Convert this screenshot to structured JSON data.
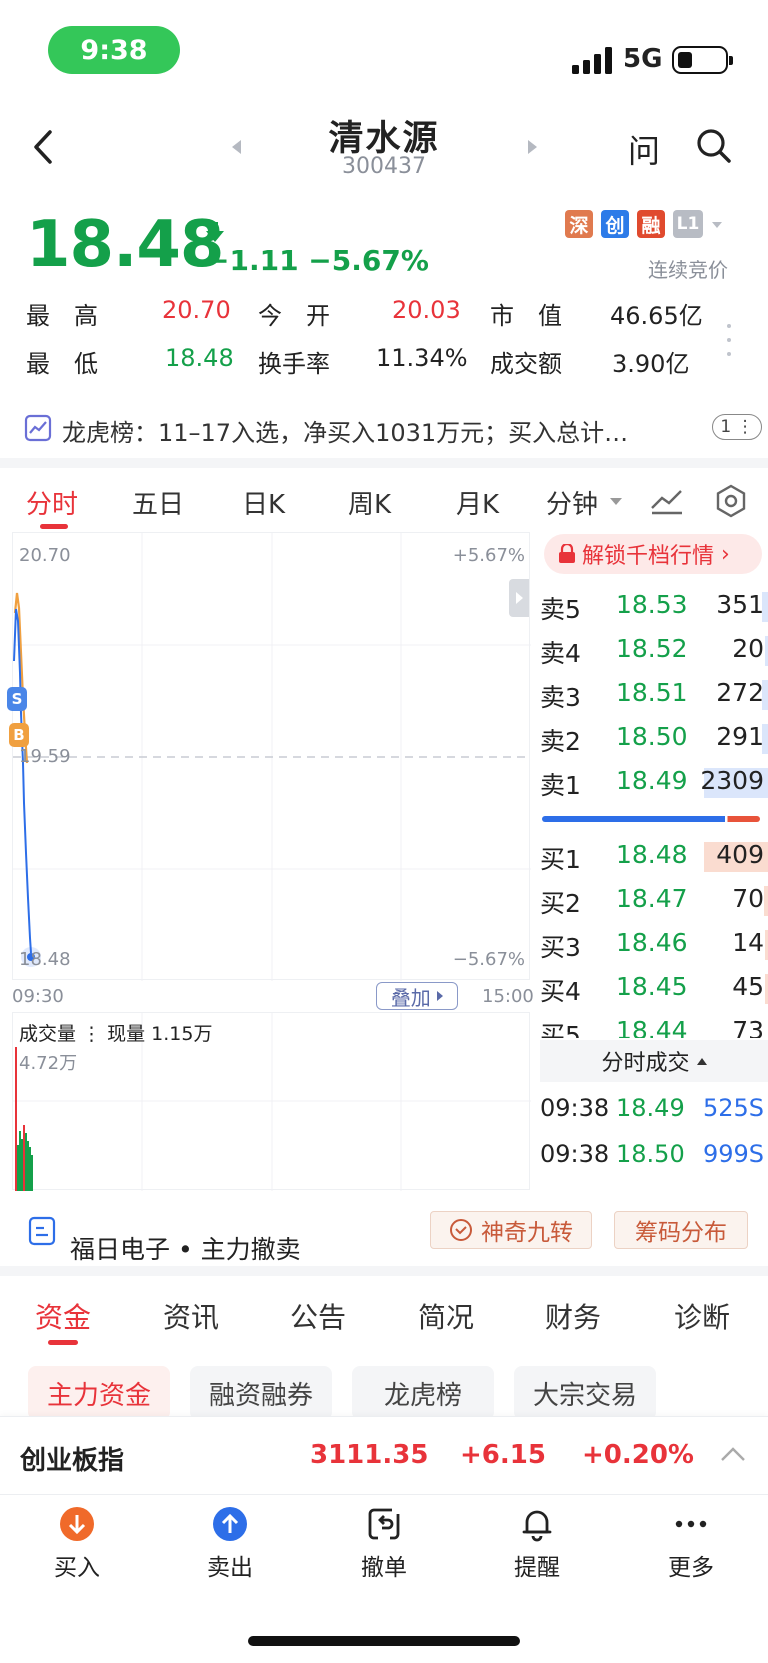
{
  "status_bar": {
    "time": "9:38",
    "network": "5G"
  },
  "header": {
    "name": "清水源",
    "code": "300437",
    "ask_label": "问"
  },
  "quote": {
    "price": "18.48",
    "change": "−1.11",
    "change_pct": "−5.67%",
    "tags": [
      "深",
      "创",
      "融",
      "L1"
    ],
    "tag_colors": [
      "#e07a4f",
      "#2d7be8",
      "#e04a2e",
      "#b8bcc4"
    ],
    "status": "连续竞价"
  },
  "stats": {
    "high_label": "最　高",
    "high": "20.70",
    "open_label": "今　开",
    "open": "20.03",
    "mcap_label": "市　值",
    "mcap": "46.65亿",
    "low_label": "最　低",
    "low": "18.48",
    "turnover_label": "换手率",
    "turnover": "11.34%",
    "amount_label": "成交额",
    "amount": "3.90亿"
  },
  "dragon": {
    "text": "龙虎榜：11–17入选，净买入1031万元；买入总计…",
    "page": "1"
  },
  "chart_tabs": [
    "分时",
    "五日",
    "日K",
    "周K",
    "月K",
    "分钟"
  ],
  "chart": {
    "y_top": "20.70",
    "y_mid": "19.59",
    "y_bottom": "18.48",
    "pct_top": "+5.67%",
    "pct_bottom": "−5.67%",
    "t_start": "09:30",
    "t_end": "15:00",
    "overlay_label": "叠加",
    "sell_marker": "S",
    "buy_marker": "B"
  },
  "volume": {
    "title": "成交量",
    "current": "现量 1.15万",
    "max": "4.72万"
  },
  "orderbook": {
    "unlock_label": "解锁千档行情",
    "asks": [
      {
        "label": "卖5",
        "price": "18.53",
        "vol": "351"
      },
      {
        "label": "卖4",
        "price": "18.52",
        "vol": "20"
      },
      {
        "label": "卖3",
        "price": "18.51",
        "vol": "272"
      },
      {
        "label": "卖2",
        "price": "18.50",
        "vol": "291"
      },
      {
        "label": "卖1",
        "price": "18.49",
        "vol": "2309"
      }
    ],
    "bids": [
      {
        "label": "买1",
        "price": "18.48",
        "vol": "409"
      },
      {
        "label": "买2",
        "price": "18.47",
        "vol": "70"
      },
      {
        "label": "买3",
        "price": "18.46",
        "vol": "14"
      },
      {
        "label": "买4",
        "price": "18.45",
        "vol": "45"
      },
      {
        "label": "买5",
        "price": "18.44",
        "vol": "73"
      }
    ],
    "ticks_label": "分时成交",
    "ticks": [
      {
        "time": "09:38",
        "price": "18.49",
        "vol": "525S"
      },
      {
        "time": "09:38",
        "price": "18.50",
        "vol": "999S"
      }
    ]
  },
  "info": {
    "company": "福日电子",
    "event": "主力撤卖",
    "magic_label": "神奇九转",
    "chips_label": "筹码分布"
  },
  "bottom_tabs": [
    "资金",
    "资讯",
    "公告",
    "简况",
    "财务",
    "诊断"
  ],
  "chips": [
    "主力资金",
    "融资融券",
    "龙虎榜",
    "大宗交易"
  ],
  "index_bar": {
    "name": "创业板指",
    "value": "3111.35",
    "change": "+6.15",
    "pct": "+0.20%"
  },
  "nav": [
    "买入",
    "卖出",
    "撤单",
    "提醒",
    "更多"
  ]
}
